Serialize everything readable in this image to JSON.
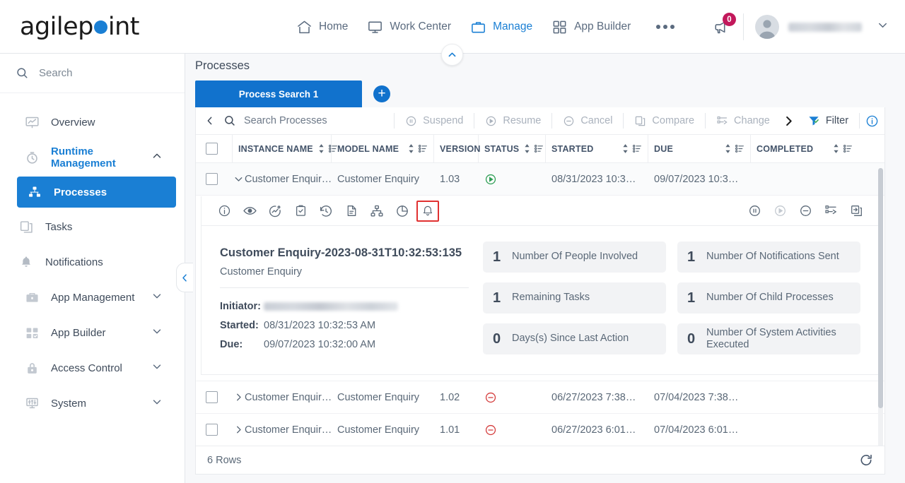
{
  "header": {
    "logo_text_before": "agilep",
    "logo_text_after": "int",
    "nav": [
      {
        "label": "Home",
        "icon": "home-icon",
        "active": false
      },
      {
        "label": "Work Center",
        "icon": "monitor-icon",
        "active": false
      },
      {
        "label": "Manage",
        "icon": "briefcase-icon",
        "active": true
      },
      {
        "label": "App Builder",
        "icon": "grid-icon",
        "active": false
      }
    ],
    "more_label": "More",
    "announcement_badge": "0",
    "user_name": "",
    "accent_color": "#1a7fd4",
    "badge_color": "#c2185b"
  },
  "sidebar": {
    "search_placeholder": "Search",
    "items": [
      {
        "label": "Overview",
        "icon": "overview-chart-icon",
        "state": "normal"
      },
      {
        "label": "Runtime Management",
        "icon": "clock-icon",
        "state": "expanded"
      },
      {
        "label": "Processes",
        "icon": "process-hierarchy-icon",
        "state": "selected"
      },
      {
        "label": "Tasks",
        "icon": "tasks-icon",
        "state": "normal"
      },
      {
        "label": "Notifications",
        "icon": "bell-icon",
        "state": "normal"
      },
      {
        "label": "App Management",
        "icon": "briefcase-icon",
        "state": "collapsed"
      },
      {
        "label": "App Builder",
        "icon": "grid-check-icon",
        "state": "collapsed"
      },
      {
        "label": "Access Control",
        "icon": "lock-icon",
        "state": "collapsed"
      },
      {
        "label": "System",
        "icon": "sliders-icon",
        "state": "collapsed"
      }
    ]
  },
  "main": {
    "page_title": "Processes",
    "tab_label": "Process Search 1",
    "add_tab_label": "+",
    "toolbar": {
      "search_placeholder": "Search Processes",
      "buttons": [
        {
          "label": "Suspend",
          "icon": "pause-circle-icon",
          "enabled": false
        },
        {
          "label": "Resume",
          "icon": "play-circle-icon",
          "enabled": false
        },
        {
          "label": "Cancel",
          "icon": "minus-circle-icon",
          "enabled": false
        },
        {
          "label": "Compare",
          "icon": "compare-icon",
          "enabled": false
        },
        {
          "label": "Change",
          "icon": "change-version-icon",
          "enabled": false
        }
      ],
      "filter_label": "Filter"
    },
    "table": {
      "columns": [
        {
          "label": "INSTANCE NAME"
        },
        {
          "label": "MODEL NAME"
        },
        {
          "label": "VERSION"
        },
        {
          "label": "STATUS"
        },
        {
          "label": "STARTED"
        },
        {
          "label": "DUE"
        },
        {
          "label": "COMPLETED"
        }
      ],
      "rows": [
        {
          "instance_name": "Customer Enquir…",
          "model_name": "Customer Enquiry",
          "version": "1.03",
          "status": "running",
          "started": "08/31/2023 10:3…",
          "due": "09/07/2023 10:3…",
          "completed": "",
          "expanded": true
        },
        {
          "instance_name": "Customer Enquir…",
          "model_name": "Customer Enquiry",
          "version": "1.02",
          "status": "cancelled",
          "started": "06/27/2023 7:38…",
          "due": "07/04/2023 7:38…",
          "completed": "",
          "expanded": false
        },
        {
          "instance_name": "Customer Enquir…",
          "model_name": "Customer Enquiry",
          "version": "1.01",
          "status": "cancelled",
          "started": "06/27/2023 6:01…",
          "due": "07/04/2023 6:01…",
          "completed": "",
          "expanded": false
        }
      ],
      "rows_count_label": "6 Rows"
    },
    "detail": {
      "icon_bar_left": [
        {
          "name": "info-icon",
          "highlighted": false
        },
        {
          "name": "eye-icon",
          "highlighted": false
        },
        {
          "name": "activity-chart-icon",
          "highlighted": false
        },
        {
          "name": "clipboard-check-icon",
          "highlighted": false
        },
        {
          "name": "history-icon",
          "highlighted": false
        },
        {
          "name": "document-icon",
          "highlighted": false
        },
        {
          "name": "hierarchy-icon",
          "highlighted": false
        },
        {
          "name": "pie-chart-icon",
          "highlighted": false
        },
        {
          "name": "notification-bell-icon",
          "highlighted": true
        }
      ],
      "icon_bar_right": [
        {
          "name": "pause-circle-icon",
          "dim": false
        },
        {
          "name": "play-circle-icon",
          "dim": true
        },
        {
          "name": "minus-circle-icon",
          "dim": false
        },
        {
          "name": "change-version-icon",
          "dim": false
        },
        {
          "name": "migrate-copy-icon",
          "dim": false
        }
      ],
      "title": "Customer Enquiry-2023-08-31T10:32:53:135",
      "subtitle": "Customer Enquiry",
      "fields": [
        {
          "label": "Initiator:",
          "value": ""
        },
        {
          "label": "Started:",
          "value": "08/31/2023 10:32:53 AM"
        },
        {
          "label": "Due:",
          "value": "09/07/2023 10:32:00 AM"
        }
      ],
      "stats": [
        {
          "value": "1",
          "label": "Number Of People Involved"
        },
        {
          "value": "1",
          "label": "Number Of Notifications Sent"
        },
        {
          "value": "1",
          "label": "Remaining Tasks"
        },
        {
          "value": "1",
          "label": "Number Of Child Processes"
        },
        {
          "value": "0",
          "label": "Days(s) Since Last Action"
        },
        {
          "value": "0",
          "label": "Number Of System Activities Executed"
        }
      ],
      "highlight_color": "#e03131"
    }
  }
}
